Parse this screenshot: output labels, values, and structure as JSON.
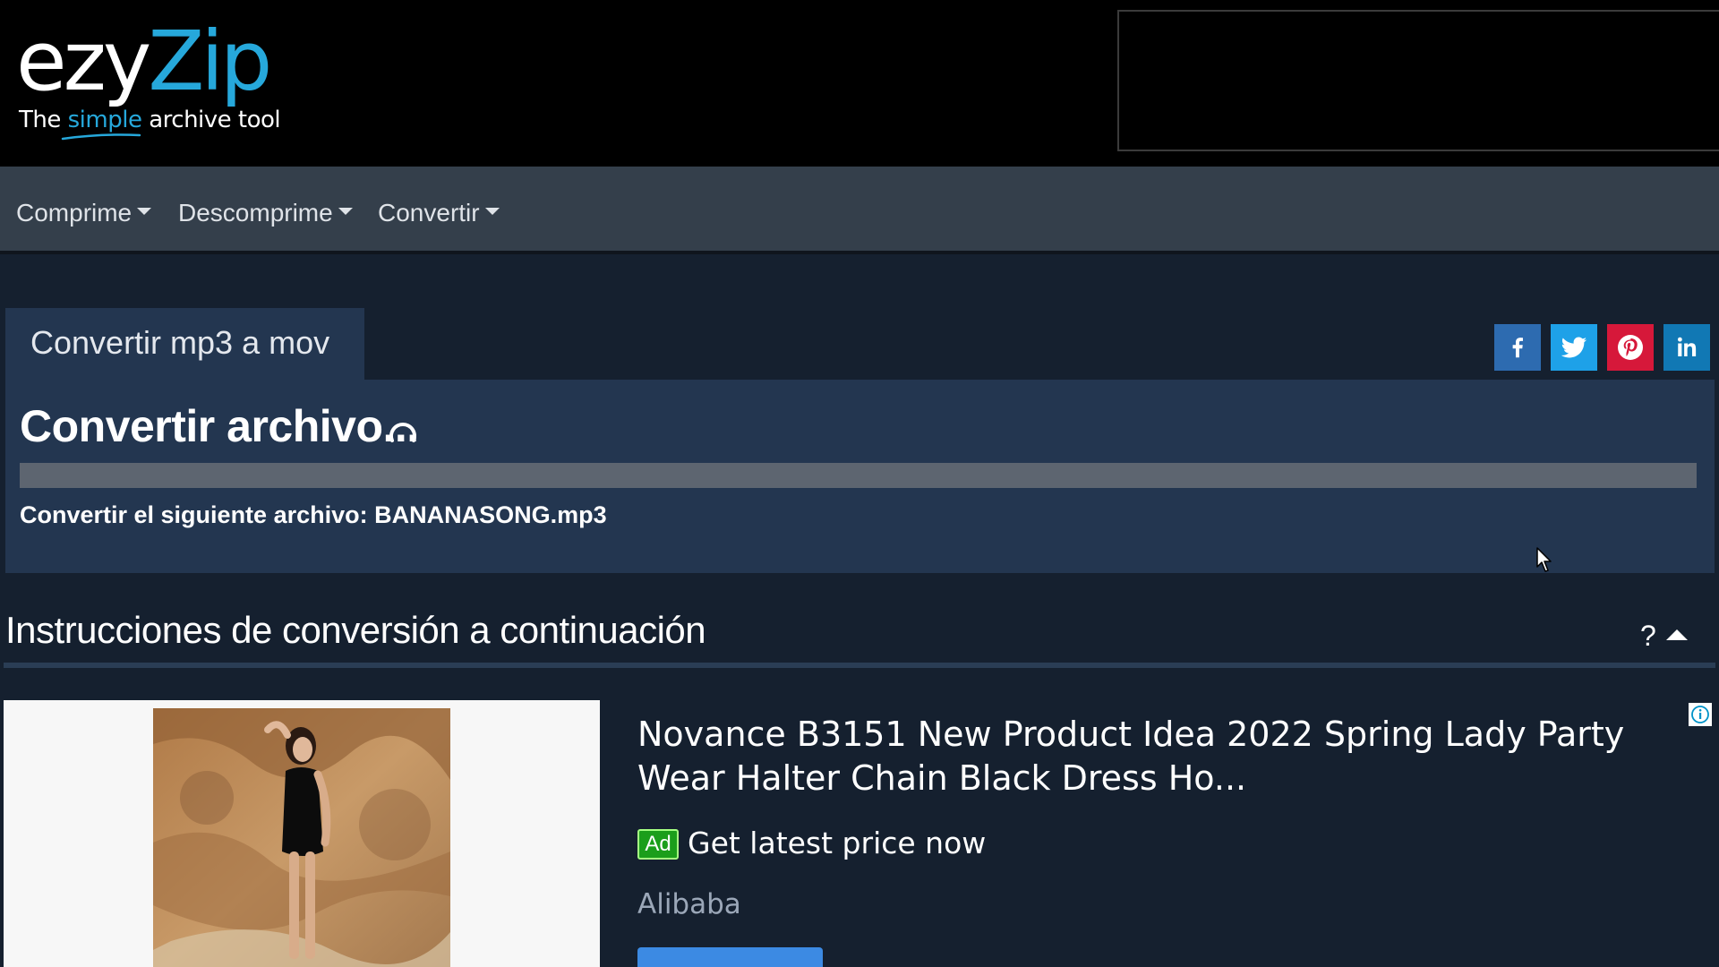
{
  "header": {
    "logo": {
      "part1": "ezy",
      "part2": "Zip"
    },
    "tagline": {
      "before": "The ",
      "highlight": "simple",
      "after": " archive tool"
    }
  },
  "nav": {
    "items": [
      {
        "label": "Comprime"
      },
      {
        "label": "Descomprime"
      },
      {
        "label": "Convertir"
      }
    ]
  },
  "tool": {
    "tab_label": "Convertir mp3 a mov",
    "heading": "Convertir archivo...",
    "progress_fraction": 0,
    "file_line": "Convertir el siguiente archivo: BANANASONG.mp3"
  },
  "share": {
    "icons": [
      "facebook-icon",
      "twitter-icon",
      "pinterest-icon",
      "linkedin-icon"
    ]
  },
  "instructions": {
    "title": "Instrucciones de conversión a continuación",
    "help_text": "?"
  },
  "native_ad": {
    "headline": "Novance B3151 New Product Idea 2022 Spring Lady Party Wear Halter Chain Black Dress Ho...",
    "badge": "Ad",
    "cta": "Get latest price now",
    "source": "Alibaba"
  },
  "colors": {
    "brand_accent": "#26a8db",
    "page_background": "#15202f",
    "panel_background": "#233650",
    "navbar_background": "#343f4b",
    "progress_track": "#5d6570"
  }
}
